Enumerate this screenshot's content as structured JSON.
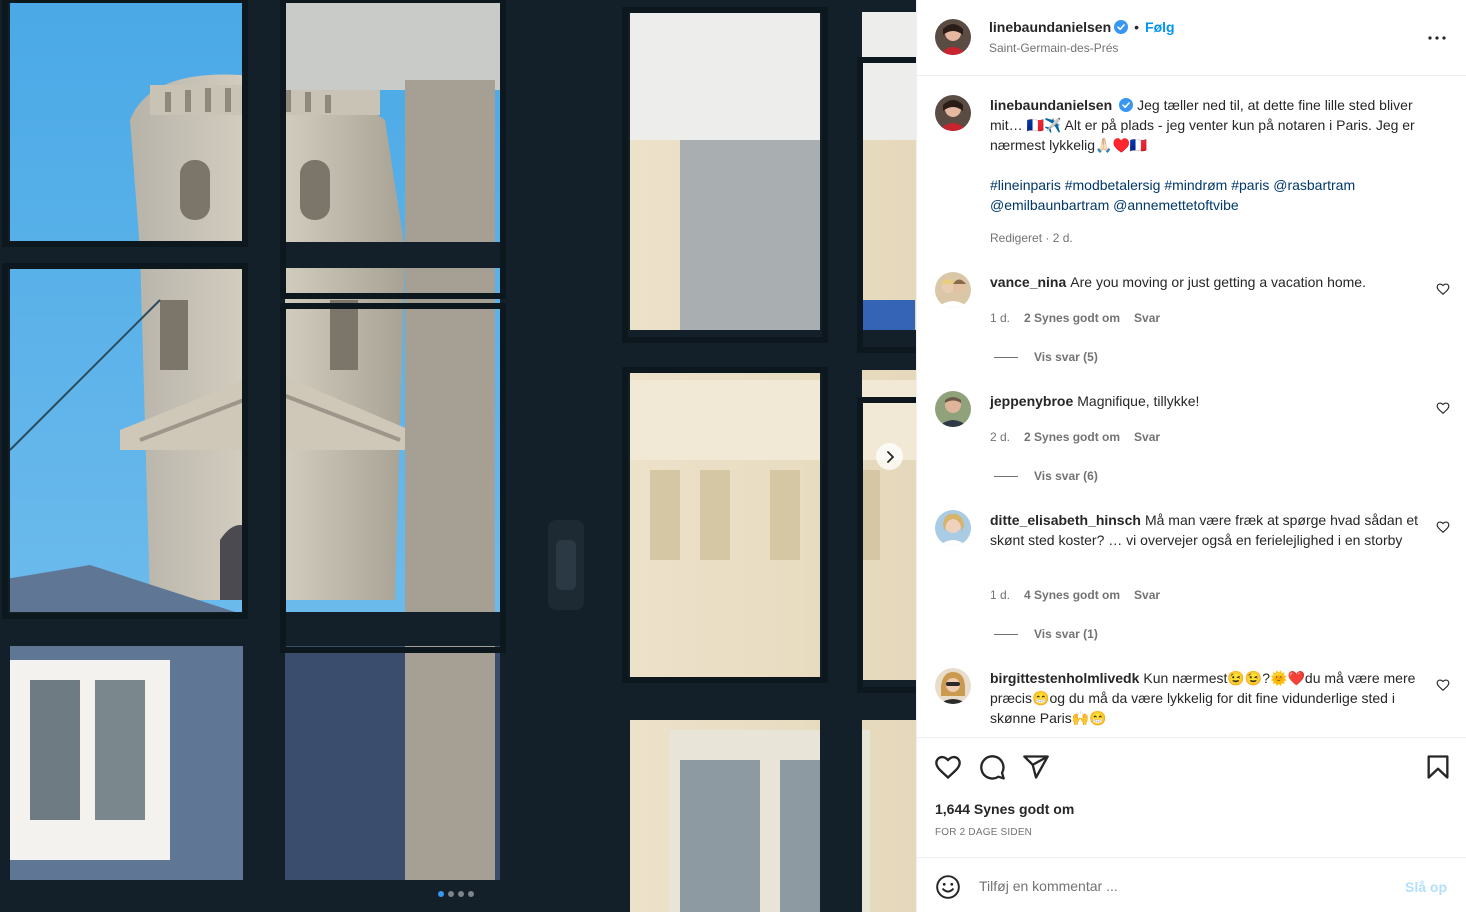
{
  "post": {
    "author": "linebaundanielsen",
    "follow_label": "Følg",
    "location": "Saint-Germain-des-Prés",
    "caption_text": "Jeg tæller ned til, at dette fine lille sted bliver mit… 🇫🇷✈️ Alt er på plads - jeg venter kun på notaren i Paris. Jeg er nærmest lykkelig🙏🏻♥️🇫🇷",
    "hashtags": "#lineinparis #modbetalersig #mindrøm #paris @rasbartram @emilbaunbartram @annemettetoftvibe",
    "caption_meta": "Redigeret · 2 d.",
    "likes": "1,644 Synes godt om",
    "time_ago": "FOR 2 DAGE SIDEN"
  },
  "comments": [
    {
      "username": "vance_nina",
      "text": "Are you moving or just getting a vacation home.",
      "age": "1 d.",
      "likes": "2 Synes godt om",
      "reply": "Svar",
      "view_replies": "Vis svar (5)"
    },
    {
      "username": "jeppenybroe",
      "text": "Magnifique, tillykke!",
      "age": "2 d.",
      "likes": "2 Synes godt om",
      "reply": "Svar",
      "view_replies": "Vis svar (6)"
    },
    {
      "username": "ditte_elisabeth_hinsch",
      "text": "Må man være fræk at spørge hvad sådan et skønt sted koster? … vi overvejer også en ferielejlighed i en storby",
      "age": "1 d.",
      "likes": "4 Synes godt om",
      "reply": "Svar",
      "view_replies": "Vis svar (1)"
    },
    {
      "username": "birgittestenholmlivedk",
      "text": "Kun nærmest😉😉?🌞❤️du må være mere præcis😁og du må da være lykkelig for dit fine vidunderlige sted i skønne Paris🙌😁"
    }
  ],
  "add_comment": {
    "placeholder": "Tilføj en kommentar ...",
    "post_label": "Slå op"
  },
  "icons": {
    "verified": "verified-badge-icon",
    "more": "more-options-icon",
    "like": "heart-icon",
    "comment": "comment-icon",
    "share": "share-icon",
    "save": "bookmark-icon",
    "emoji": "emoji-icon",
    "next": "chevron-right-icon"
  },
  "carousel": {
    "slides": 4,
    "active": 1
  },
  "colors": {
    "accent": "#0095f6",
    "verified": "#3897f0",
    "text": "#262626",
    "muted": "#737373",
    "hashtag": "#00376b"
  }
}
